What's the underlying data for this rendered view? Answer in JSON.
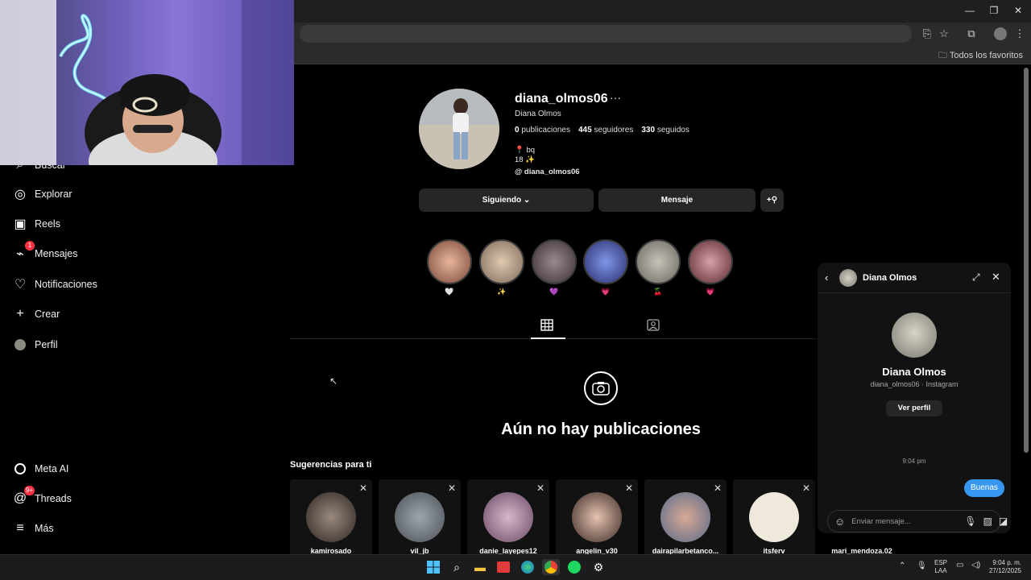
{
  "browser": {
    "bookmarks_label": "Todos los favoritos",
    "window_controls": [
      "minimize-icon",
      "restore-icon",
      "close-icon"
    ]
  },
  "sidebar": {
    "items": [
      {
        "label": "Buscar",
        "icon": "search-icon"
      },
      {
        "label": "Explorar",
        "icon": "compass-icon"
      },
      {
        "label": "Reels",
        "icon": "reels-icon"
      },
      {
        "label": "Mensajes",
        "icon": "messenger-icon",
        "badge": "1"
      },
      {
        "label": "Notificaciones",
        "icon": "heart-icon"
      },
      {
        "label": "Crear",
        "icon": "plus-icon"
      },
      {
        "label": "Perfil",
        "icon": "avatar-icon"
      }
    ],
    "bottom": [
      {
        "label": "Meta AI",
        "icon": "meta-ai-icon"
      },
      {
        "label": "Threads",
        "icon": "threads-icon",
        "badge": "9+"
      },
      {
        "label": "Más",
        "icon": "menu-icon"
      }
    ]
  },
  "profile": {
    "username": "diana_olmos06",
    "full_name": "Diana Olmos",
    "posts_count": "0",
    "posts_label": "publicaciones",
    "followers_count": "445",
    "followers_label": "seguidores",
    "following_count": "330",
    "following_label": "seguidos",
    "bio_line1": "📍 bq",
    "bio_line2": "18 ✨",
    "threads_handle": "diana_olmos06",
    "following_button": "Siguiendo",
    "message_button": "Mensaje",
    "add_user_icon": "add-person-icon",
    "highlights": [
      "🤍",
      "✨",
      "💜",
      "💗",
      "🍒",
      "💗"
    ],
    "empty_title": "Aún no hay publicaciones"
  },
  "suggestions": {
    "title": "Sugerencias para ti",
    "users": [
      "kamirosado",
      "vil_jb",
      "danie_layepes12",
      "angelin_v30",
      "dairapilarbetanco...",
      "itsferv",
      "mari_mendoza.02"
    ]
  },
  "chat": {
    "name": "Diana Olmos",
    "subtitle": "diana_olmos06 · Instagram",
    "view_profile": "Ver perfil",
    "time": "9:04 pm",
    "message": "Buenas",
    "input_placeholder": "Enviar mensaje..."
  },
  "taskbar": {
    "lang_line1": "ESP",
    "lang_line2": "LAA",
    "clock_time": "9:04 p. m.",
    "clock_date": "27/12/2025"
  },
  "colors": {
    "background": "#000000",
    "card": "#121212",
    "button": "#262626",
    "accent_blue": "#3797f0",
    "badge_red": "#ff3040"
  }
}
